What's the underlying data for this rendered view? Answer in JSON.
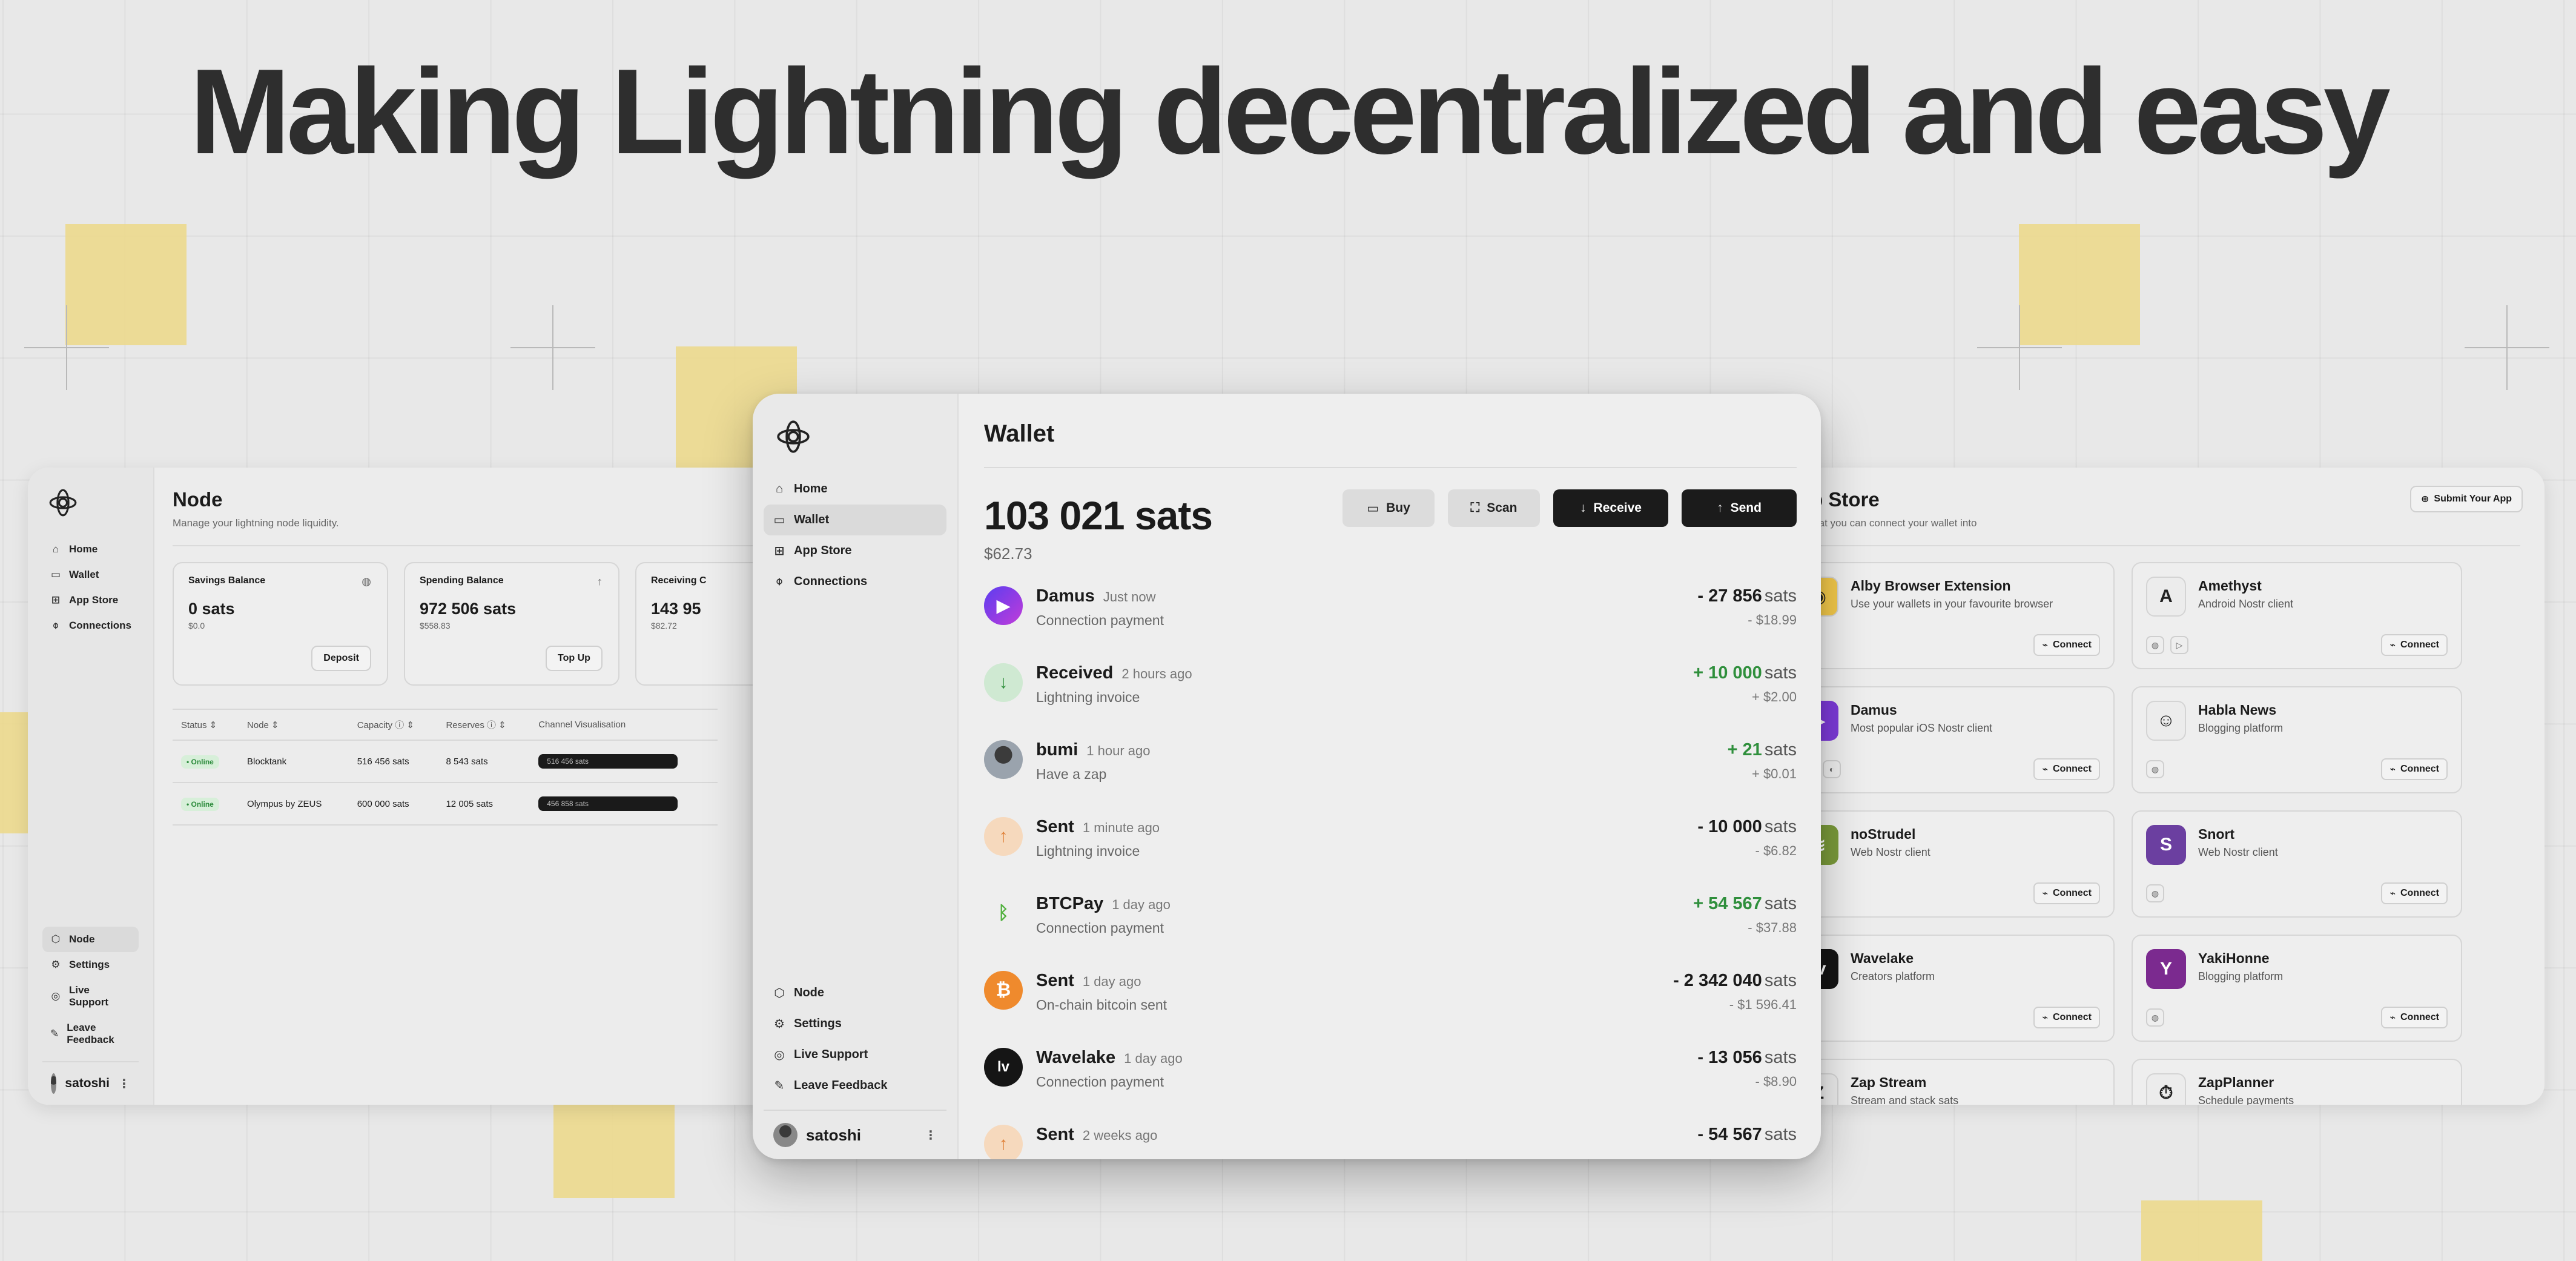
{
  "headline": "Making Lightning decentralized and easy",
  "colors": {
    "accent_tile": "#ecd98e",
    "dark_button": "#1b1b1b",
    "positive": "#2f8f3c"
  },
  "node_window": {
    "nav": [
      "Home",
      "Wallet",
      "App Store",
      "Connections"
    ],
    "bottom_nav": [
      "Node",
      "Settings",
      "Live Support",
      "Leave Feedback"
    ],
    "user": "satoshi",
    "title": "Node",
    "subtitle": "Manage your lightning node liquidity.",
    "cards": [
      {
        "title": "Savings Balance",
        "amount": "0 sats",
        "fiat": "$0.0",
        "button": "Deposit"
      },
      {
        "title": "Spending Balance",
        "amount": "972 506 sats",
        "fiat": "$558.83",
        "button": "Top Up"
      },
      {
        "title": "Receiving C",
        "amount": "143 95",
        "fiat": "$82.72"
      }
    ],
    "table_headers": [
      "Status",
      "Node",
      "Capacity",
      "Reserves",
      "Channel Visualisation"
    ],
    "rows": [
      {
        "status": "• Online",
        "node": "Blocktank",
        "capacity": "516 456 sats",
        "reserves": "8 543 sats",
        "bar": "516 456 sats"
      },
      {
        "status": "• Online",
        "node": "Olympus by ZEUS",
        "capacity": "600 000 sats",
        "reserves": "12 005 sats",
        "bar": "456 858 sats"
      }
    ]
  },
  "wallet_window": {
    "nav": [
      "Home",
      "Wallet",
      "App Store",
      "Connections"
    ],
    "bottom_nav": [
      "Node",
      "Settings",
      "Live Support",
      "Leave Feedback"
    ],
    "user": "satoshi",
    "title": "Wallet",
    "balance": "103 021 sats",
    "balance_fiat": "$62.73",
    "actions": {
      "buy": "Buy",
      "scan": "Scan",
      "receive": "Receive",
      "send": "Send"
    },
    "unit": "sats",
    "transactions": [
      {
        "name": "Damus",
        "time": "Just now",
        "desc": "Connection payment",
        "sats": "- 27 856",
        "fiat": "- $18.99",
        "positive": false,
        "icon": "damus-icon"
      },
      {
        "name": "Received",
        "time": "2 hours ago",
        "desc": "Lightning invoice",
        "sats": "+ 10 000",
        "fiat": "+ $2.00",
        "positive": true,
        "icon": "arrow-down-icon"
      },
      {
        "name": "bumi",
        "time": "1 hour ago",
        "desc": "Have a zap",
        "sats": "+ 21",
        "fiat": "+ $0.01",
        "positive": true,
        "icon": "avatar-icon"
      },
      {
        "name": "Sent",
        "time": "1 minute ago",
        "desc": "Lightning invoice",
        "sats": "- 10 000",
        "fiat": "- $6.82",
        "positive": false,
        "icon": "arrow-up-icon"
      },
      {
        "name": "BTCPay",
        "time": "1 day ago",
        "desc": "Connection payment",
        "sats": "+ 54 567",
        "fiat": "- $37.88",
        "positive": true,
        "icon": "btcpay-icon"
      },
      {
        "name": "Sent",
        "time": "1 day ago",
        "desc": "On-chain bitcoin sent",
        "sats": "- 2 342 040",
        "fiat": "- $1 596.41",
        "positive": false,
        "icon": "bitcoin-icon"
      },
      {
        "name": "Wavelake",
        "time": "1 day ago",
        "desc": "Connection payment",
        "sats": "- 13 056",
        "fiat": "- $8.90",
        "positive": false,
        "icon": "wavelake-icon"
      },
      {
        "name": "Sent",
        "time": "2 weeks ago",
        "desc": "",
        "sats": "- 54 567",
        "fiat": "",
        "positive": false,
        "icon": "arrow-up-icon"
      }
    ]
  },
  "appstore_window": {
    "title": "App Store",
    "subtitle": "Apps that you can connect your wallet into",
    "submit": "Submit Your App",
    "connect": "Connect",
    "apps": [
      {
        "name": "Alby Browser Extension",
        "desc": "Use your wallets in your favourite browser",
        "icon": "alby-icon",
        "bg": "#f3c94a",
        "glyph": "◉"
      },
      {
        "name": "Amethyst",
        "desc": "Android Nostr client",
        "icon": "amethyst-icon",
        "bg": "#ececec",
        "glyph": "A"
      },
      {
        "name": "Damus",
        "desc": "Most popular iOS Nostr client",
        "icon": "damus-icon",
        "bg": "#7d3bd9",
        "glyph": "▶"
      },
      {
        "name": "Habla News",
        "desc": "Blogging platform",
        "icon": "habla-icon",
        "bg": "#ececec",
        "glyph": "☺"
      },
      {
        "name": "noStrudel",
        "desc": "Web Nostr client",
        "icon": "nostrudel-icon",
        "bg": "#7a9a3a",
        "glyph": "≋"
      },
      {
        "name": "Snort",
        "desc": "Web Nostr client",
        "icon": "snort-icon",
        "bg": "#6b3fa0",
        "glyph": "S"
      },
      {
        "name": "Wavelake",
        "desc": "Creators platform",
        "icon": "wavelake-icon",
        "bg": "#151515",
        "glyph": "lv"
      },
      {
        "name": "YakiHonne",
        "desc": "Blogging platform",
        "icon": "yakihonne-icon",
        "bg": "#7b2a8f",
        "glyph": "Y"
      },
      {
        "name": "Zap Stream",
        "desc": "Stream and stack sats",
        "icon": "zapstream-icon",
        "bg": "#ececec",
        "glyph": "Z"
      },
      {
        "name": "ZapPlanner",
        "desc": "Schedule payments",
        "icon": "zapplanner-icon",
        "bg": "#ececec",
        "glyph": "⏱"
      }
    ]
  }
}
